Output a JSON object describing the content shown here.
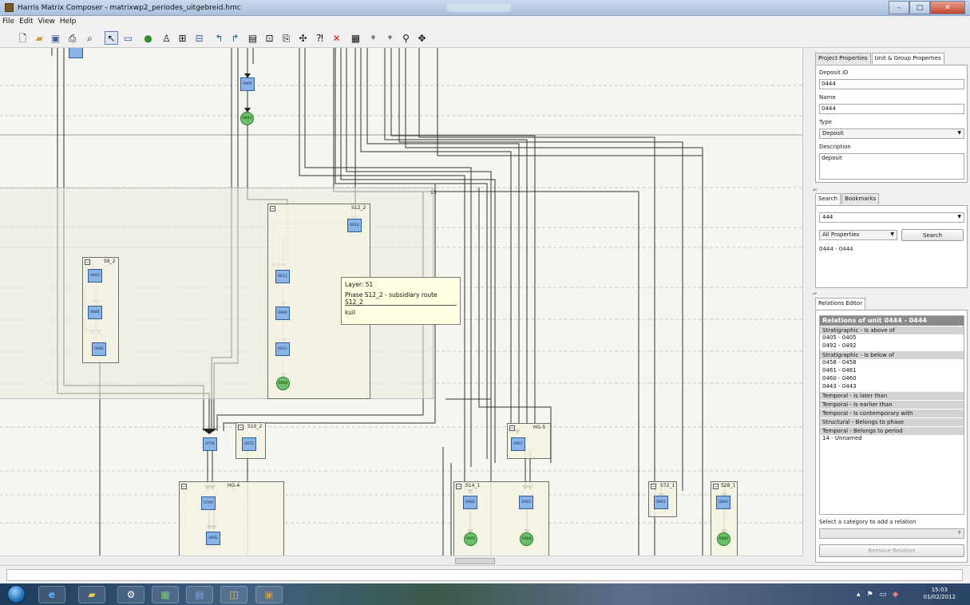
{
  "window": {
    "title": "Harris Matrix Composer - matrixwp2_periodes_uitgebreid.hmc",
    "controls": [
      "–",
      "□",
      "✕"
    ]
  },
  "menu": [
    "File",
    "Edit",
    "View",
    "Help"
  ],
  "toolbar_icons": [
    "new-icon",
    "open-icon",
    "save-icon",
    "print-icon",
    "print-preview-icon",
    "pointer-icon",
    "unit-icon",
    "circle-unit-icon",
    "person-icon",
    "group-icon",
    "subgroup-icon",
    "arrow-up-icon",
    "arrow-up-right-icon",
    "table-icon",
    "grid-icon",
    "export-icon",
    "settings-icon",
    "help-icon",
    "delete-icon",
    "fit-icon",
    "zoom-in-icon",
    "zoom-out-icon",
    "zoom-icon",
    "pan-icon"
  ],
  "canvas": {
    "nodes": [
      {
        "id": "0895",
        "shape": "rect"
      },
      {
        "id": "0894",
        "shape": "circle"
      },
      {
        "id": "0810",
        "shape": "rect"
      },
      {
        "id": "0811",
        "shape": "rect"
      },
      {
        "id": "0809",
        "shape": "rect"
      },
      {
        "id": "0812",
        "shape": "rect"
      },
      {
        "id": "0808",
        "shape": "circle"
      },
      {
        "id": "0683",
        "shape": "rect"
      },
      {
        "id": "0684",
        "shape": "rect"
      },
      {
        "id": "0685",
        "shape": "rect"
      },
      {
        "id": "0756",
        "shape": "rect"
      },
      {
        "id": "0872",
        "shape": "rect"
      },
      {
        "id": "0967",
        "shape": "rect"
      },
      {
        "id": "0790",
        "shape": "rect"
      },
      {
        "id": "0892",
        "shape": "rect"
      },
      {
        "id": "0966",
        "shape": "rect"
      },
      {
        "id": "0965",
        "shape": "circle"
      },
      {
        "id": "0963",
        "shape": "rect"
      },
      {
        "id": "0968",
        "shape": "circle"
      },
      {
        "id": "0691",
        "shape": "rect"
      },
      {
        "id": "0890",
        "shape": "rect"
      },
      {
        "id": "0889",
        "shape": "circle"
      }
    ],
    "groups": [
      "S12_2",
      "S9_2",
      "S10_2",
      "HG-5",
      "HG-4",
      "S14_1",
      "S72_1",
      "S28_1"
    ],
    "panel_label": "13",
    "tooltip": {
      "layer": "Layer: 51",
      "phase": "Phase S12_2 - subsidiary route S12_2",
      "desc": "kuil"
    }
  },
  "unit_props": {
    "tabs": [
      "Project Properties",
      "Unit & Group Properties"
    ],
    "active_tab": 1,
    "deposit_id_label": "Deposit ID",
    "deposit_id": "0444",
    "name_label": "Name",
    "name": "0444",
    "type_label": "Type",
    "type": "Deposit",
    "description_label": "Description",
    "description": "deposit"
  },
  "search": {
    "tabs": [
      "Search",
      "Bookmarks"
    ],
    "query": "444",
    "scope": "All Properties",
    "button": "Search",
    "results": [
      "0444 - 0444"
    ]
  },
  "relations": {
    "tab": "Relations Editor",
    "header": "Relations of unit 0444 - 0444",
    "groups": [
      {
        "category": "Stratigraphic - Is above of",
        "items": [
          "0405 - 0405",
          "0492 - 0492"
        ]
      },
      {
        "category": "Stratigraphic - Is below of",
        "items": [
          "0458 - 0458",
          "0461 - 0461",
          "0460 - 0460",
          "0443 - 0443"
        ]
      },
      {
        "category": "Temporal - Is later than",
        "items": []
      },
      {
        "category": "Temporal - Is earlier than",
        "items": []
      },
      {
        "category": "Temporal - Is contemporary with",
        "items": []
      },
      {
        "category": "Structural - Belongs to phase",
        "items": []
      },
      {
        "category": "Temporal - Belongs to period",
        "items": [
          "14 - Unnamed"
        ]
      }
    ],
    "add_label": "Select a category to add a relation",
    "remove_button": "Remove Relation"
  },
  "taskbar": {
    "time": "15:03",
    "date": "01/02/2012"
  },
  "colors": {
    "unit_fill": "#8bb4e6",
    "unit_border": "#2f5c98",
    "circle_fill": "#6cc06c",
    "tooltip_bg": "#ffffe1",
    "delete_red": "#dd2222"
  }
}
